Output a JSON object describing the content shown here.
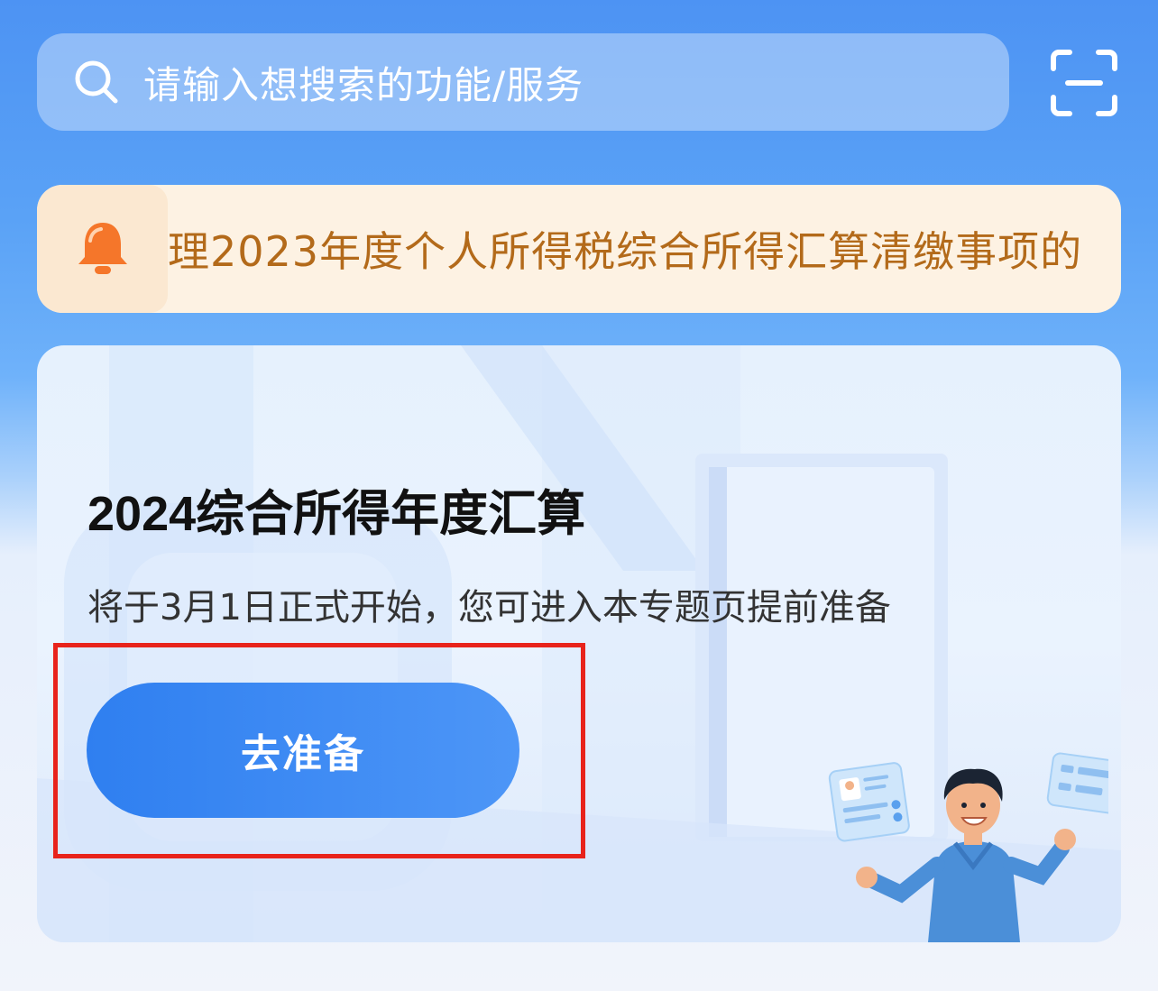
{
  "search": {
    "placeholder": "请输入想搜索的功能/服务"
  },
  "icons": {
    "search": "search-icon",
    "scan": "scan-icon",
    "bell": "bell-icon"
  },
  "notice": {
    "text": "理2023年度个人所得税综合所得汇算清缴事项的"
  },
  "card": {
    "title": "2024综合所得年度汇算",
    "subtitle": "将于3月1日正式开始，您可进入本专题页提前准备",
    "button_label": "去准备"
  },
  "colors": {
    "primary": "#2f7ff0",
    "notice_text": "#b36a1a",
    "bell": "#f5762a",
    "highlight": "#e8231b"
  }
}
